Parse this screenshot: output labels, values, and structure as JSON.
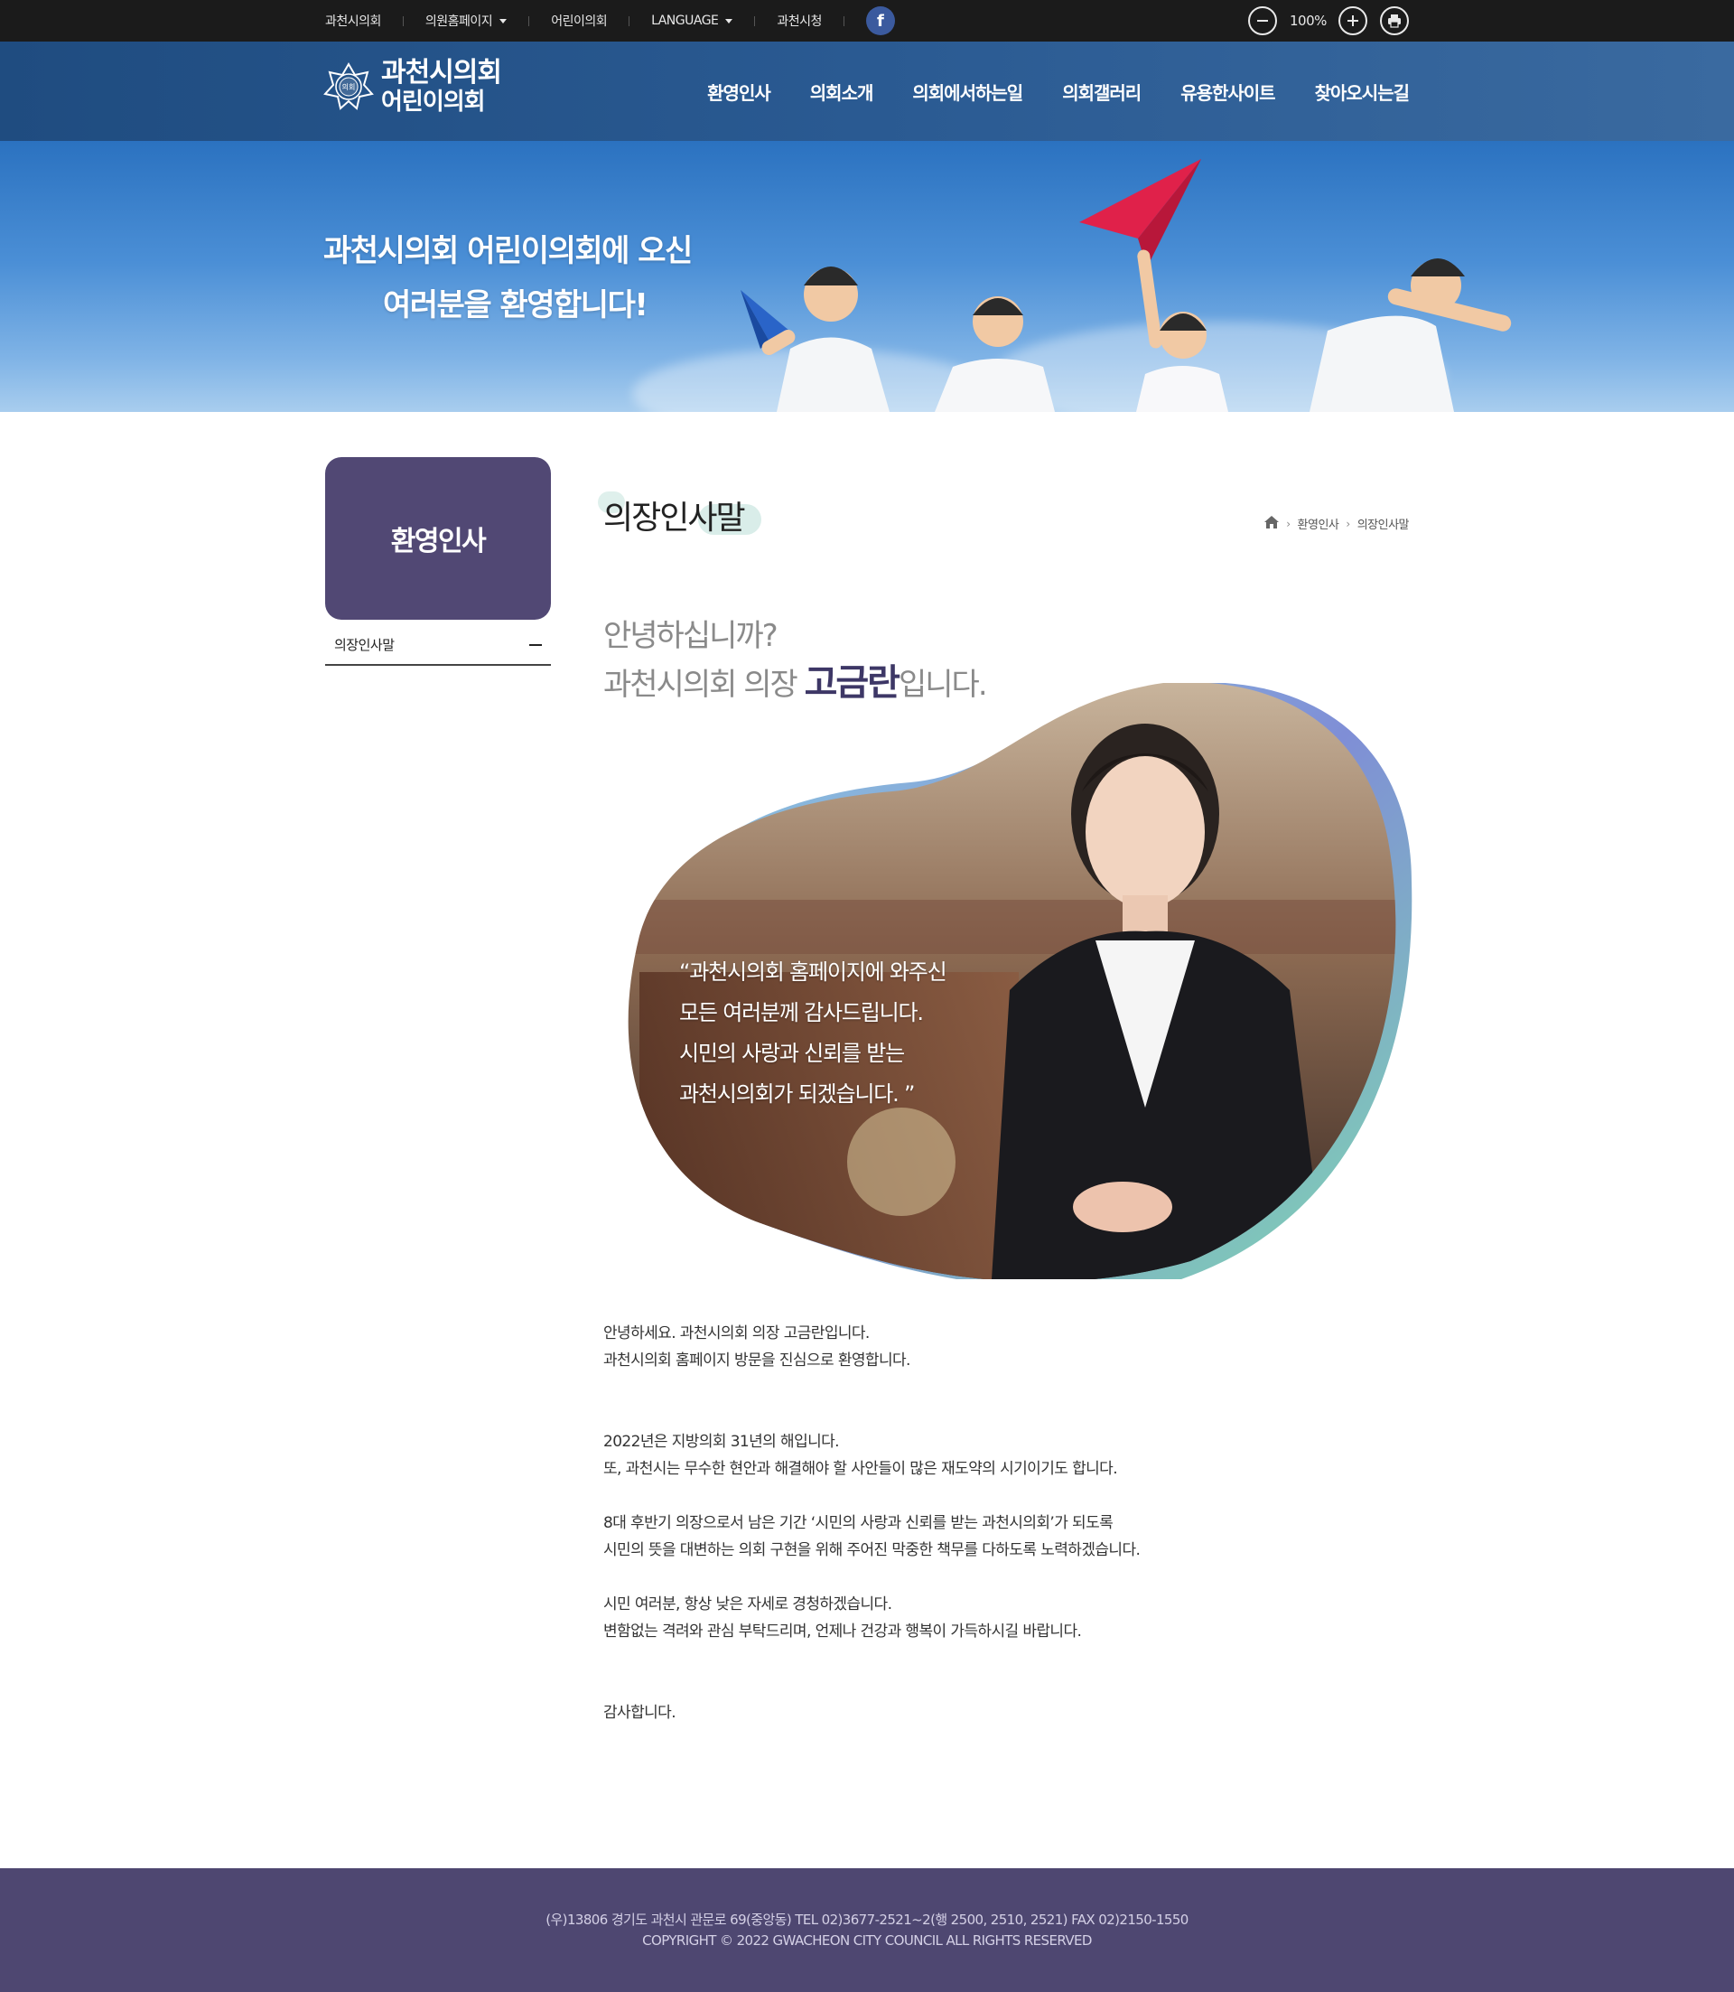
{
  "topbar": {
    "links": [
      {
        "label": "과천시의회",
        "dropdown": false
      },
      {
        "label": "의원홈페이지",
        "dropdown": true
      },
      {
        "label": "어린이의회",
        "dropdown": false
      },
      {
        "label": "LANGUAGE",
        "dropdown": true
      },
      {
        "label": "과천시청",
        "dropdown": false
      }
    ],
    "facebook_icon": "facebook-icon",
    "zoom_level": "100%"
  },
  "header": {
    "logo_line1": "과천시의회",
    "logo_line2": "어린이의회",
    "seal_text": "의회",
    "nav": [
      "환영인사",
      "의회소개",
      "의회에서하는일",
      "의회갤러리",
      "유용한사이트",
      "찾아오시는길"
    ]
  },
  "hero": {
    "line1": "과천시의회 어린이의회에 오신",
    "line2": "여러분을 환영합니다!"
  },
  "sidebar": {
    "title": "환영인사",
    "items": [
      {
        "label": "의장인사말"
      }
    ]
  },
  "content": {
    "page_title": "의장인사말",
    "breadcrumb": [
      "환영인사",
      "의장인사말"
    ],
    "greeting_line1": "안녕하십니까?",
    "greeting_line2_prefix": "과천시의회 의장 ",
    "greeting_name": "고금란",
    "greeting_line2_suffix": "입니다.",
    "quote": [
      "“과천시의회 홈페이지에 와주신",
      "모든 여러분께 감사드립니다.",
      "시민의 사랑과 신뢰를 받는",
      "과천시의회가 되겠습니다. ”"
    ],
    "paragraphs": [
      [
        "안녕하세요. 과천시의회 의장 고금란입니다.",
        "과천시의회 홈페이지 방문을 진심으로 환영합니다."
      ],
      [
        "2022년은 지방의회 31년의 해입니다.",
        "또, 과천시는 무수한 현안과 해결해야 할 사안들이 많은 재도약의 시기이기도 합니다."
      ],
      [
        "8대 후반기 의장으로서 남은 기간 ‘시민의 사랑과 신뢰를 받는 과천시의회’가 되도록",
        "시민의 뜻을 대변하는 의회 구현을 위해 주어진 막중한 책무를 다하도록 노력하겠습니다."
      ],
      [
        "시민 여러분, 항상 낮은 자세로 경청하겠습니다.",
        "변함없는 격려와 관심 부탁드리며, 언제나 건강과 행복이 가득하시길 바랍니다."
      ],
      [
        "감사합니다."
      ]
    ]
  },
  "footer": {
    "address": "(우)13806 경기도 과천시 관문로 69(중앙동) TEL 02)3677-2521~2(행 2500, 2510, 2521) FAX 02)2150-1550",
    "copyright": "COPYRIGHT © 2022 GWACHEON CITY COUNCIL ALL RIGHTS RESERVED"
  },
  "colors": {
    "topbar_bg": "#1b1b1b",
    "header_bg": "#2a5a92",
    "sidebar_box": "#514874",
    "name_accent": "#3d3766",
    "footer_bg": "#4e4771"
  }
}
